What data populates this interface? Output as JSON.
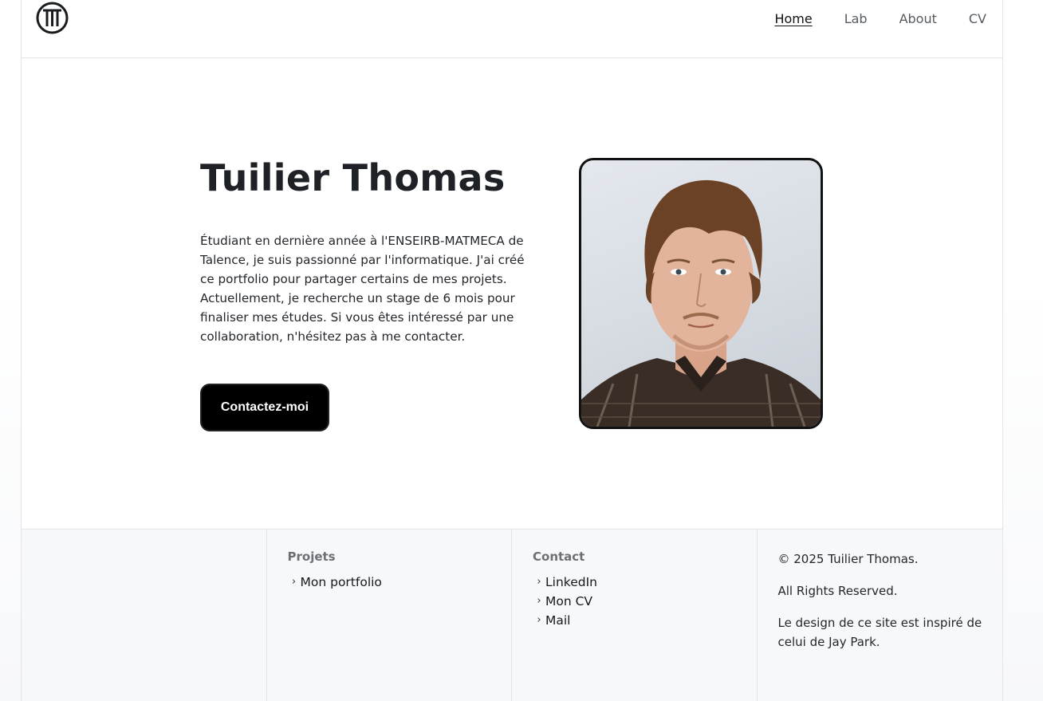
{
  "header": {
    "logo_letter": "T",
    "nav": [
      {
        "label": "Home",
        "active": true
      },
      {
        "label": "Lab",
        "active": false
      },
      {
        "label": "About",
        "active": false
      },
      {
        "label": "CV",
        "active": false
      }
    ]
  },
  "hero": {
    "title": "Tuilier Thomas",
    "description": "Étudiant en dernière année à l'ENSEIRB-MATMECA de Talence, je suis passionné par l'informatique. J'ai créé ce portfolio pour partager certains de mes projets. Actuellement, je recherche un stage de 6 mois pour finaliser mes études. Si vous êtes intéressé par une collaboration, n'hésitez pas à me contacter.",
    "cta_label": "Contactez-moi"
  },
  "footer": {
    "projects": {
      "heading": "Projets",
      "items": [
        "Mon portfolio"
      ]
    },
    "contact": {
      "heading": "Contact",
      "items": [
        "LinkedIn",
        "Mon CV",
        "Mail"
      ]
    },
    "notes": {
      "copyright": "© 2025 Tuilier Thomas.",
      "rights": "All Rights Reserved.",
      "credit": "Le design de ce site est inspiré de celui de Jay Park."
    }
  },
  "colors": {
    "accent": "#000000",
    "border": "#e3e5e8",
    "footer_bg": "#f7f8fa"
  },
  "icons": {
    "logo": "circle-t-logo",
    "list_marker": "chevron-right-icon"
  }
}
